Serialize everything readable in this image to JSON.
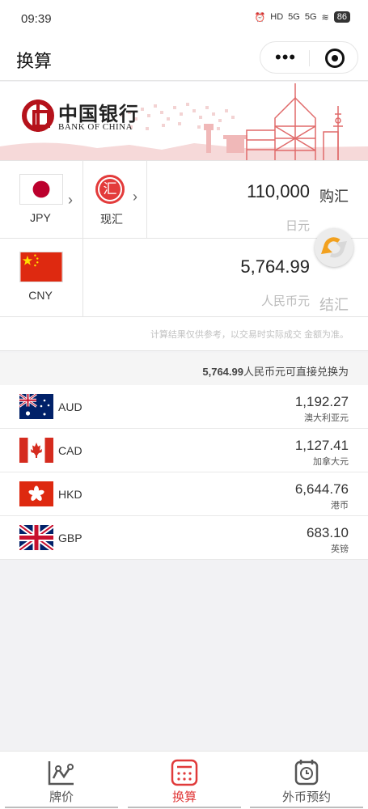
{
  "status_bar": {
    "time": "09:39",
    "signal_1": "5G",
    "signal_2": "5G",
    "battery": "86"
  },
  "nav": {
    "title": "换算"
  },
  "bank": {
    "name_cn": "中国银行",
    "name_en": "BANK OF CHINA"
  },
  "converter": {
    "from": {
      "code": "JPY",
      "mode_char": "汇",
      "mode_label": "现汇",
      "amount": "110,000",
      "currency_name": "日元",
      "side": "购汇"
    },
    "to": {
      "code": "CNY",
      "amount": "5,764.99",
      "currency_name": "人民币元",
      "side": "结汇"
    }
  },
  "disclaimer": "计算结果仅供参考，以交易时实际成交 金额为准。",
  "direct": {
    "amount": "5,764.99",
    "text": "人民币元可直接兑换为"
  },
  "conversions": [
    {
      "code": "AUD",
      "value": "1,192.27",
      "name": "澳大利亚元",
      "flag": "aud-flag"
    },
    {
      "code": "CAD",
      "value": "1,127.41",
      "name": "加拿大元",
      "flag": "cad-flag"
    },
    {
      "code": "HKD",
      "value": "6,644.76",
      "name": "港币",
      "flag": "hkd-flag"
    },
    {
      "code": "GBP",
      "value": "683.10",
      "name": "英镑",
      "flag": "gbp-flag"
    }
  ],
  "tabs": [
    {
      "label": "牌价",
      "icon": "chart-icon"
    },
    {
      "label": "换算",
      "icon": "calculator-icon"
    },
    {
      "label": "外币预约",
      "icon": "alarm-clock-icon"
    }
  ],
  "colors": {
    "accent": "#e03a3a",
    "bank_red": "#b5121b"
  }
}
